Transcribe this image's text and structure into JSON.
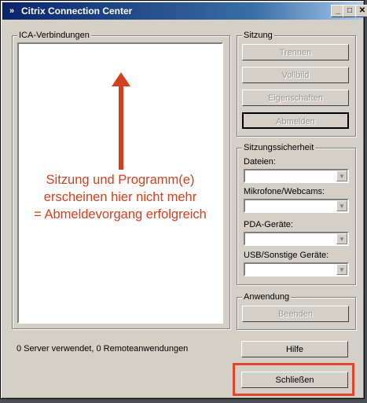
{
  "window": {
    "title": "Citrix Connection Center",
    "icon": "citrix-logo-icon",
    "minimize": "_",
    "maximize": "□",
    "close": "✕"
  },
  "connections": {
    "legend": "ICA-Verbindungen"
  },
  "session": {
    "legend": "Sitzung",
    "buttons": [
      "Trennen",
      "Vollbild",
      "Eigenschaften",
      "Abmelden"
    ]
  },
  "security": {
    "legend": "Sitzungssicherheit",
    "fields": [
      {
        "label": "Dateien:",
        "value": ""
      },
      {
        "label": "Mikrofone/Webcams:",
        "value": ""
      },
      {
        "label": "PDA-Geräte:",
        "value": ""
      },
      {
        "label": "USB/Sonstige Geräte:",
        "value": ""
      }
    ]
  },
  "application": {
    "legend": "Anwendung",
    "end_button": "Beenden"
  },
  "status_text": "0 Server verwendet, 0 Remoteanwendungen",
  "help_button": "Hilfe",
  "close_button": "Schließen",
  "annotation": {
    "text": "Sitzung und Programm(e)\nerscheinen hier nicht mehr\n= Abmeldevorgang erfolgreich",
    "color": "#d2411e"
  },
  "colors": {
    "titlebar_start": "#0a246a",
    "titlebar_end": "#a6caf0",
    "window_face": "#d4d0c8",
    "highlight": "#e0472a"
  }
}
